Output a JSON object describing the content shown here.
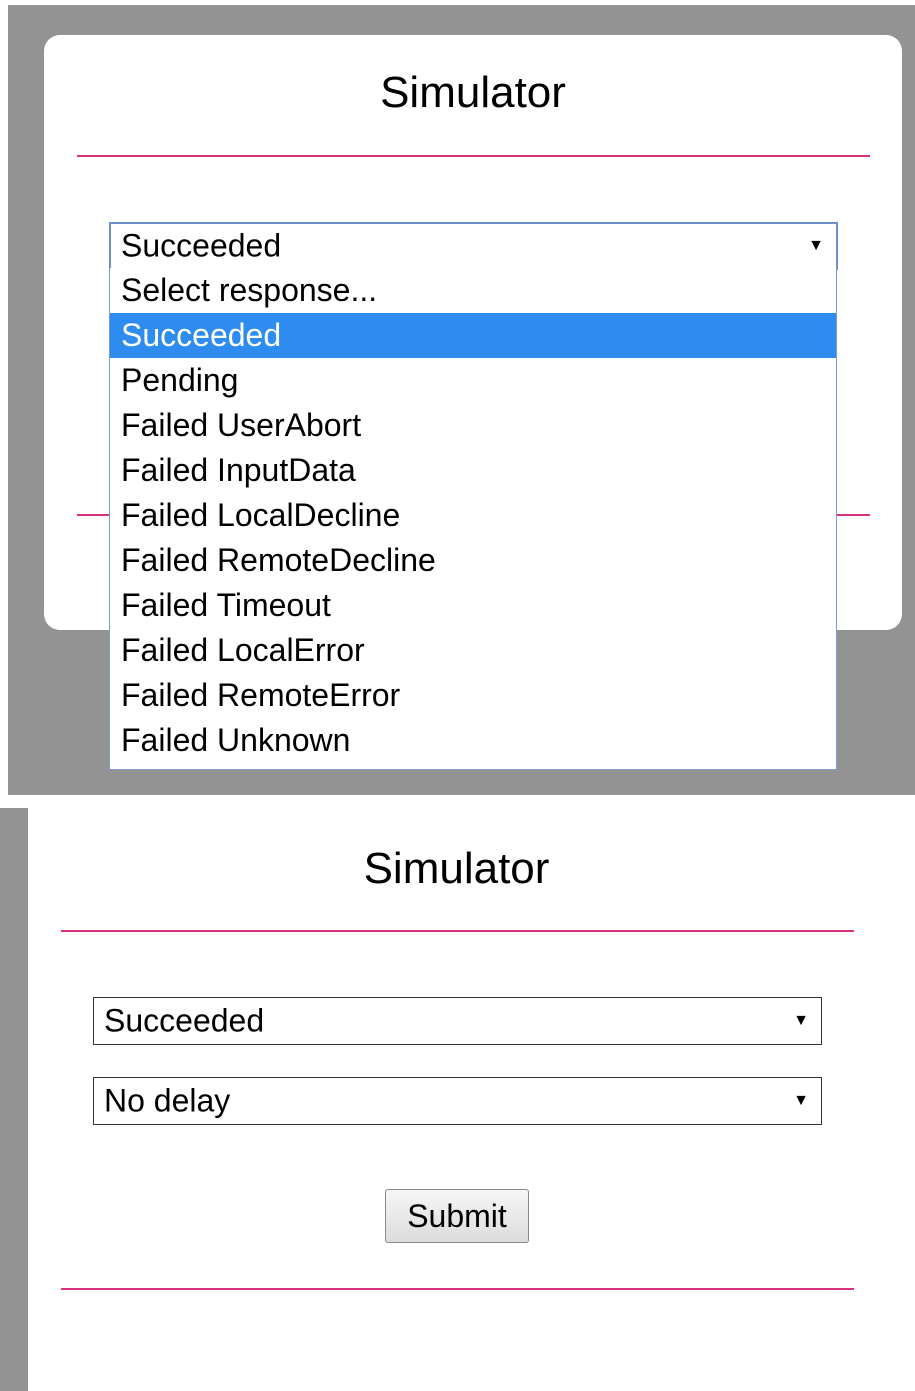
{
  "top": {
    "title": "Simulator",
    "response_select": {
      "value": "Succeeded",
      "arrow": "▼"
    },
    "dropdown_options": [
      "Select response...",
      "Succeeded",
      "Pending",
      "Failed UserAbort",
      "Failed InputData",
      "Failed LocalDecline",
      "Failed RemoteDecline",
      "Failed Timeout",
      "Failed LocalError",
      "Failed RemoteError",
      "Failed Unknown"
    ],
    "selected_option": "Succeeded"
  },
  "bottom": {
    "title": "Simulator",
    "response_select": {
      "value": "Succeeded",
      "arrow": "▼"
    },
    "delay_select": {
      "value": "No delay",
      "arrow": "▼"
    },
    "submit_label": "Submit"
  },
  "colors": {
    "accent_rule": "#d6327e",
    "option_highlight": "#2e8cf0",
    "backdrop": "#939393"
  },
  "icons": {
    "dropdown_arrow": "chevron-down-icon"
  }
}
